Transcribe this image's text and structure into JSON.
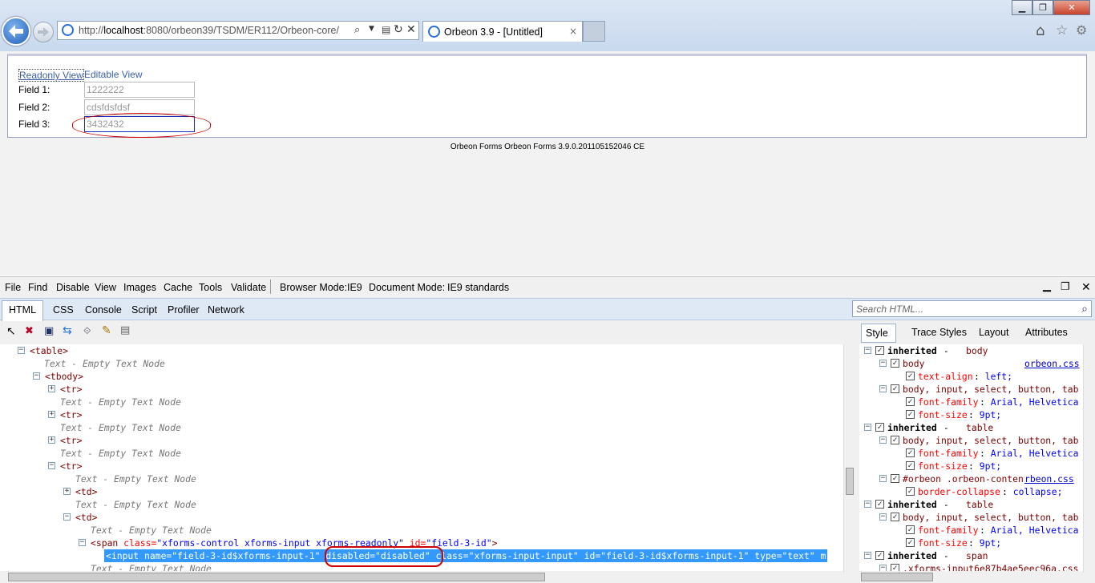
{
  "browser": {
    "url_prefix": "http://",
    "url_host": "localhost",
    "url_rest": ":8080/orbeon39/TSDM/ER112/Orbeon-core/",
    "tab_title": "Orbeon 3.9 - [Untitled]",
    "tab_close": "×"
  },
  "page": {
    "readonly_link": "Readonly View",
    "editable_link": "Editable View",
    "fields": [
      {
        "label": "Field 1:",
        "value": "1222222"
      },
      {
        "label": "Field 2:",
        "value": "cdsfdsfdsf"
      },
      {
        "label": "Field 3:",
        "value": "3432432"
      }
    ],
    "footer": "Orbeon Forms Orbeon Forms 3.9.0.201105152046 CE"
  },
  "devtools": {
    "menu": [
      "File",
      "Find",
      "Disable",
      "View",
      "Images",
      "Cache",
      "Tools",
      "Validate"
    ],
    "browser_mode_label": "Browser Mode:",
    "browser_mode_value": "IE9",
    "document_mode_label": "Document Mode:",
    "document_mode_value": "IE9 standards",
    "tabs": [
      "HTML",
      "CSS",
      "Console",
      "Script",
      "Profiler",
      "Network"
    ],
    "search_placeholder": "Search HTML...",
    "right_tabs": [
      "Style",
      "Trace Styles",
      "Layout",
      "Attributes"
    ],
    "tree": {
      "table": "<table>",
      "empty": "Text - Empty Text Node",
      "tbody": "<tbody>",
      "tr": "<tr>",
      "td": "<td>",
      "span_open": "<span ",
      "span_class_attr": "class=",
      "span_class_val": "\"xforms-control xforms-input xforms-readonly\"",
      "span_id_attr": " id=",
      "span_id_val": "\"field-3-id\"",
      "span_close": ">",
      "input_line_1": "<input name=\"field-3-id$xforms-input-1\" ",
      "input_disabled": "disabled=\"disabled\"",
      "input_line_2": " class=\"xforms-input-input\" id=\"field-3-id$xforms-input-1\" type=\"text\" m"
    },
    "styles": [
      {
        "kind": "inherited",
        "label": "inherited",
        "sep": " - ",
        "elem": "body"
      },
      {
        "kind": "rule",
        "selector": "body",
        "source": "orbeon.css"
      },
      {
        "kind": "prop",
        "name": "text-align",
        "value": "left;"
      },
      {
        "kind": "rule",
        "selector": "body, input, select, button, tab"
      },
      {
        "kind": "prop",
        "name": "font-family",
        "value": "Arial, Helvetica"
      },
      {
        "kind": "prop",
        "name": "font-size",
        "value": "9pt;"
      },
      {
        "kind": "inherited",
        "label": "inherited",
        "sep": " - ",
        "elem": "table"
      },
      {
        "kind": "rule",
        "selector": "body, input, select, button, tab"
      },
      {
        "kind": "prop",
        "name": "font-family",
        "value": "Arial, Helvetica"
      },
      {
        "kind": "prop",
        "name": "font-size",
        "value": "9pt;"
      },
      {
        "kind": "rule",
        "selector": "#orbeon .orbeon-content",
        "source": "rbeon.css"
      },
      {
        "kind": "prop",
        "name": "border-collapse",
        "value": "collapse;"
      },
      {
        "kind": "inherited",
        "label": "inherited",
        "sep": " - ",
        "elem": "table"
      },
      {
        "kind": "rule",
        "selector": "body, input, select, button, tab"
      },
      {
        "kind": "prop",
        "name": "font-family",
        "value": "Arial, Helvetica"
      },
      {
        "kind": "prop",
        "name": "font-size",
        "value": "9pt;"
      },
      {
        "kind": "inherited",
        "label": "inherited",
        "sep": " - ",
        "elem": "span"
      },
      {
        "kind": "rule",
        "selector": ".xforms-input6e87b4ae5eec96a.css"
      }
    ],
    "highlight_color": "#3399ff",
    "annotation_color": "#cc0000"
  }
}
